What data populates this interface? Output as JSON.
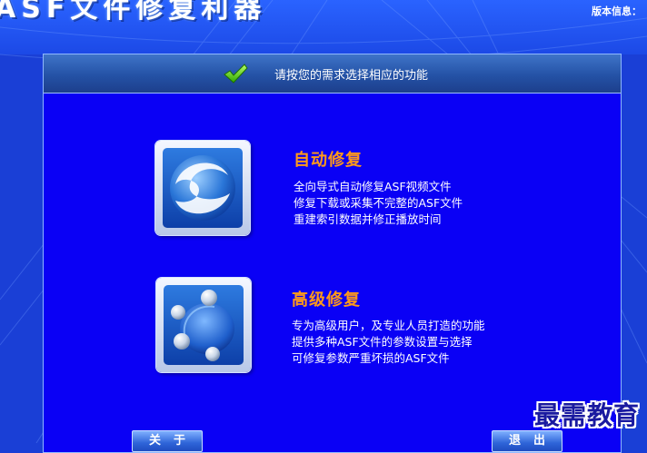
{
  "window": {
    "title": "ASF文件修复利器",
    "version_info": "版本信息："
  },
  "panel": {
    "instruction": "请按您的需求选择相应的功能"
  },
  "options": [
    {
      "icon": "auto-repair-swirl-icon",
      "title": "自动修复",
      "lines": [
        "全向导式自动修复ASF视频文件",
        "修复下载或采集不完整的ASF文件",
        "重建索引数据并修正播放时间"
      ]
    },
    {
      "icon": "advanced-repair-orbs-icon",
      "title": "高级修复",
      "lines": [
        "专为高级用户，及专业人员打造的功能",
        "提供多种ASF文件的参数设置与选择",
        "可修复参数严重坏损的ASF文件"
      ]
    }
  ],
  "buttons": {
    "about": "关于",
    "exit": "退出"
  },
  "watermark": "最需教育",
  "colors": {
    "panel_bg": "#0a00f5",
    "option_title": "#ff9a1a",
    "header_bar": "#2452a6"
  }
}
